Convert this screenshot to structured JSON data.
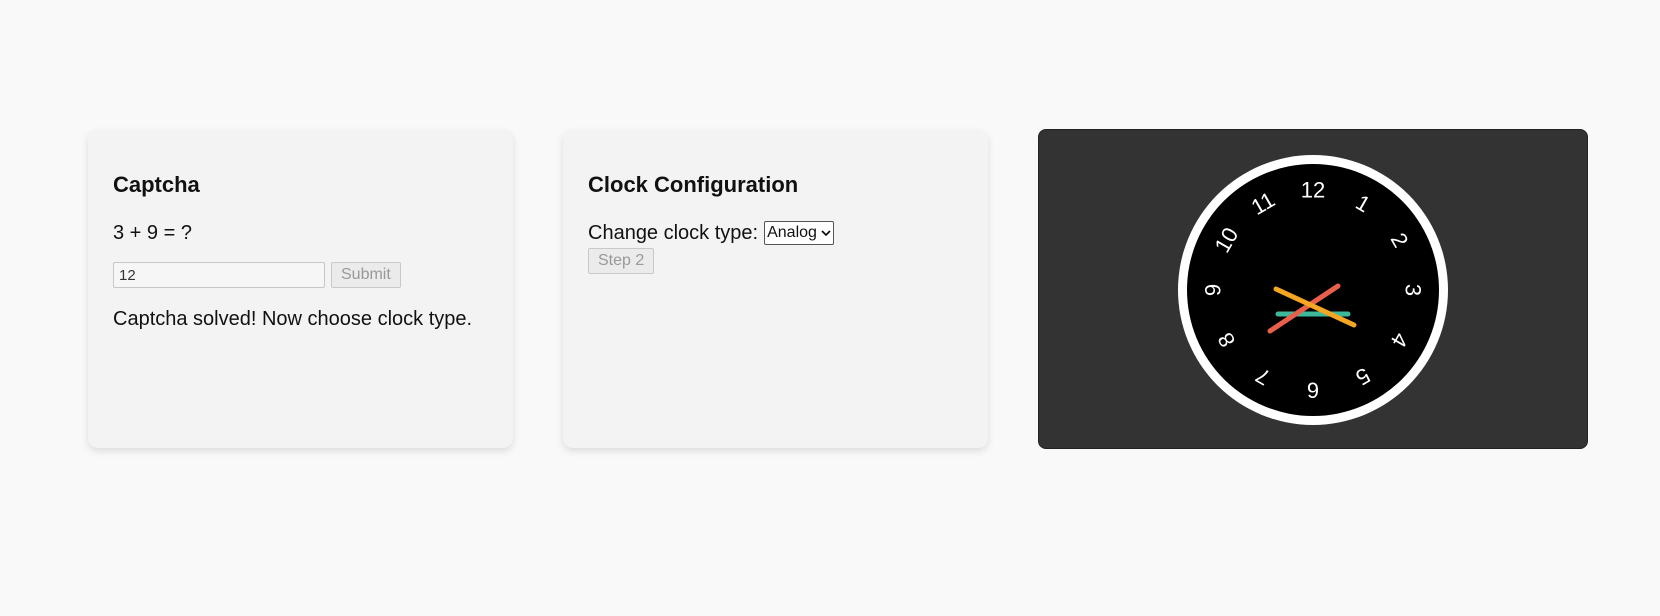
{
  "captcha": {
    "title": "Captcha",
    "question": "3 + 9 = ?",
    "answer_value": "12",
    "submit_label": "Submit",
    "status": "Captcha solved! Now choose clock type."
  },
  "config": {
    "title": "Clock Configuration",
    "label": "Change clock type:",
    "select_value": "Analog",
    "step_label": "Step 2"
  },
  "clock": {
    "numbers": [
      "1",
      "2",
      "3",
      "4",
      "5",
      "6",
      "7",
      "8",
      "9",
      "10",
      "11",
      "12"
    ],
    "colors": {
      "face": "#000000",
      "rim": "#ffffff",
      "panel": "#333333",
      "hand_orange": "#f5a623",
      "hand_red": "#e8604c",
      "hand_teal": "#3db89a"
    }
  }
}
